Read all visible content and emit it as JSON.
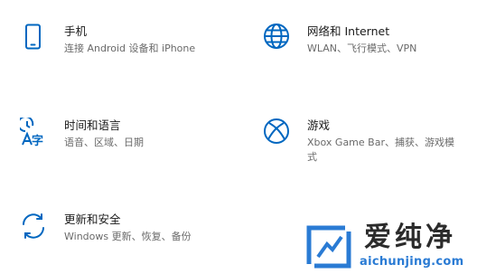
{
  "accent_color": "#0067c0",
  "tiles": [
    {
      "icon": "phone-icon",
      "title": "手机",
      "desc": "连接 Android 设备和 iPhone"
    },
    {
      "icon": "globe-icon",
      "title": "网络和 Internet",
      "desc": "WLAN、飞行模式、VPN"
    },
    {
      "icon": "time-language-icon",
      "title": "时间和语言",
      "desc": "语音、区域、日期"
    },
    {
      "icon": "xbox-icon",
      "title": "游戏",
      "desc": "Xbox Game Bar、捕获、游戏模式"
    },
    {
      "icon": "sync-arrows-icon",
      "title": "更新和安全",
      "desc": "Windows 更新、恢复、备份"
    }
  ],
  "watermark": {
    "title": "爱纯净",
    "url": "aichunjing.com",
    "title_color": "#2b2b2b",
    "url_color": "#2a7bd4"
  }
}
